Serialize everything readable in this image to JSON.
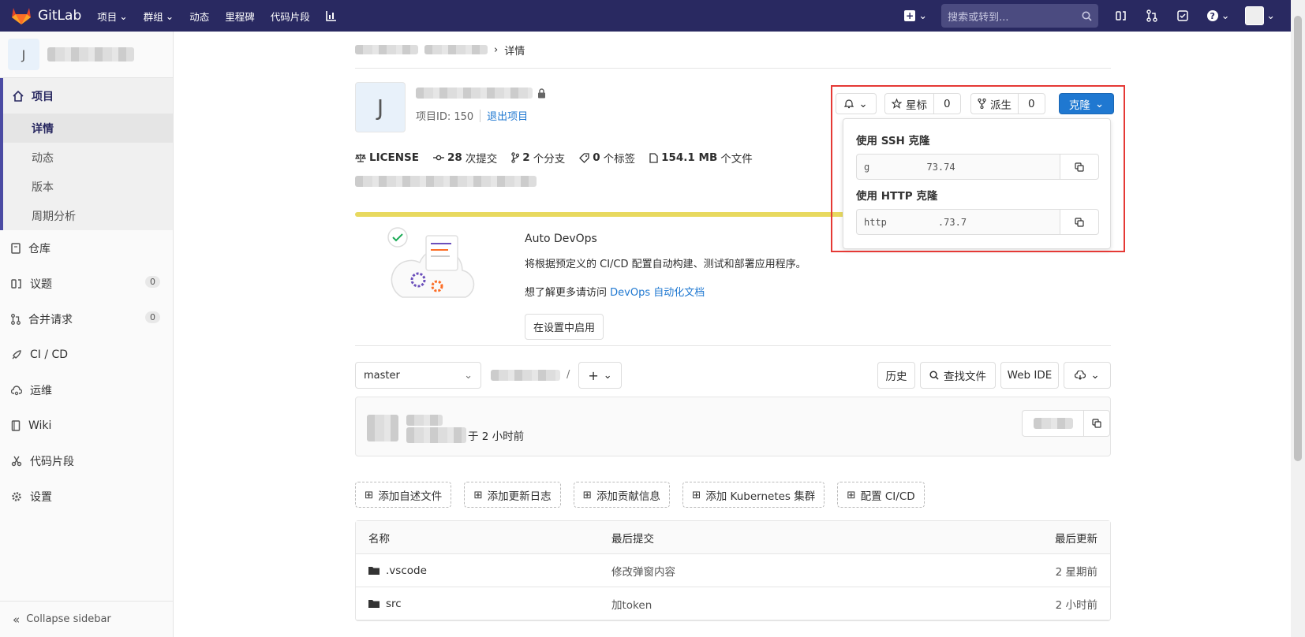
{
  "navbar": {
    "brand": "GitLab",
    "items": [
      "项目",
      "群组",
      "动态",
      "里程碑",
      "代码片段"
    ],
    "search_placeholder": "搜索或转到..."
  },
  "sidebar": {
    "context_avatar": "J",
    "section": "项目",
    "subitems": [
      "详情",
      "动态",
      "版本",
      "周期分析"
    ],
    "items": [
      {
        "label": "仓库",
        "icon": "book-icon"
      },
      {
        "label": "议题",
        "icon": "issues-icon",
        "badge": "0"
      },
      {
        "label": "合并请求",
        "icon": "merge-request-icon",
        "badge": "0"
      },
      {
        "label": "CI / CD",
        "icon": "rocket-icon"
      },
      {
        "label": "运维",
        "icon": "cloud-gear-icon"
      },
      {
        "label": "Wiki",
        "icon": "book-closed-icon"
      },
      {
        "label": "代码片段",
        "icon": "snippet-icon"
      },
      {
        "label": "设置",
        "icon": "gear-icon"
      }
    ],
    "collapse_label": "Collapse sidebar"
  },
  "breadcrumb": {
    "current": "详情"
  },
  "project": {
    "avatar": "J",
    "id_label": "项目ID: 150",
    "leave_label": "退出项目",
    "stats": [
      {
        "bold": "LICENSE",
        "text": ""
      },
      {
        "bold": "28",
        "text": "次提交"
      },
      {
        "bold": "2",
        "text": "个分支"
      },
      {
        "bold": "0",
        "text": "个标签"
      },
      {
        "bold": "154.1 MB",
        "text": "个文件"
      }
    ]
  },
  "actions": {
    "star_label": "星标",
    "star_count": "0",
    "fork_label": "派生",
    "fork_count": "0",
    "clone_label": "克隆"
  },
  "clone": {
    "ssh_label": "使用 SSH 克隆",
    "ssh_value": "g          73.74",
    "http_label": "使用 HTTP 克隆",
    "http_value": "http         .73.7"
  },
  "devops": {
    "title": "Auto DevOps",
    "desc": "将根据预定义的 CI/CD 配置自动构建、测试和部署应用程序。",
    "learn_prefix": "想了解更多请访问",
    "learn_link": "DevOps 自动化文档",
    "enable_label": "在设置中启用"
  },
  "tree": {
    "branch": "master",
    "history": "历史",
    "find_file": "查找文件",
    "web_ide": "Web IDE"
  },
  "commit": {
    "time_text": "于 2 小时前"
  },
  "shortcuts": [
    "添加自述文件",
    "添加更新日志",
    "添加贡献信息",
    "添加 Kubernetes 集群",
    "配置 CI/CD"
  ],
  "table": {
    "headers": [
      "名称",
      "最后提交",
      "最后更新"
    ],
    "rows": [
      {
        "name": ".vscode",
        "commit": "修改弹窗内容",
        "updated": "2 星期前"
      },
      {
        "name": "src",
        "commit": "加token",
        "updated": "2 小时前"
      }
    ]
  },
  "colors": {
    "navbar": "#292961",
    "primary": "#1f78d1",
    "highlight": "#e53935",
    "progress": "#e8d95f"
  }
}
